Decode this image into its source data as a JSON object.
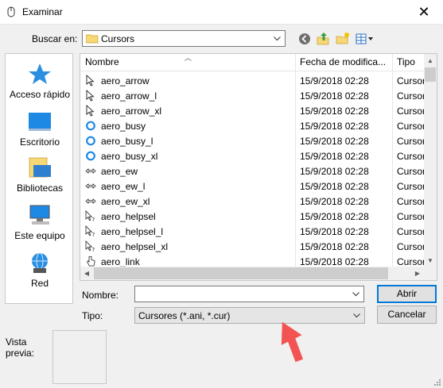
{
  "window": {
    "title": "Examinar",
    "close_glyph": "✕"
  },
  "lookin": {
    "label": "Buscar en:",
    "value": "Cursors"
  },
  "toolbar": {
    "icons": [
      "back-icon",
      "up-folder-icon",
      "new-folder-icon",
      "view-menu-icon"
    ]
  },
  "places": [
    {
      "label": "Acceso rápido",
      "icon": "star-icon"
    },
    {
      "label": "Escritorio",
      "icon": "desktop-icon"
    },
    {
      "label": "Bibliotecas",
      "icon": "libraries-icon"
    },
    {
      "label": "Este equipo",
      "icon": "computer-icon"
    },
    {
      "label": "Red",
      "icon": "network-icon"
    }
  ],
  "columns": {
    "name": "Nombre",
    "date": "Fecha de modifica...",
    "type": "Tipo"
  },
  "files": [
    {
      "name": "aero_arrow",
      "date": "15/9/2018 02:28",
      "type": "Cursor",
      "icon": "arrow"
    },
    {
      "name": "aero_arrow_l",
      "date": "15/9/2018 02:28",
      "type": "Cursor",
      "icon": "arrow"
    },
    {
      "name": "aero_arrow_xl",
      "date": "15/9/2018 02:28",
      "type": "Cursor",
      "icon": "arrow"
    },
    {
      "name": "aero_busy",
      "date": "15/9/2018 02:28",
      "type": "Cursor",
      "icon": "busy"
    },
    {
      "name": "aero_busy_l",
      "date": "15/9/2018 02:28",
      "type": "Cursor",
      "icon": "busy"
    },
    {
      "name": "aero_busy_xl",
      "date": "15/9/2018 02:28",
      "type": "Cursor",
      "icon": "busy"
    },
    {
      "name": "aero_ew",
      "date": "15/9/2018 02:28",
      "type": "Cursor",
      "icon": "ew"
    },
    {
      "name": "aero_ew_l",
      "date": "15/9/2018 02:28",
      "type": "Cursor",
      "icon": "ew"
    },
    {
      "name": "aero_ew_xl",
      "date": "15/9/2018 02:28",
      "type": "Cursor",
      "icon": "ew"
    },
    {
      "name": "aero_helpsel",
      "date": "15/9/2018 02:28",
      "type": "Cursor",
      "icon": "help"
    },
    {
      "name": "aero_helpsel_l",
      "date": "15/9/2018 02:28",
      "type": "Cursor",
      "icon": "help"
    },
    {
      "name": "aero_helpsel_xl",
      "date": "15/9/2018 02:28",
      "type": "Cursor",
      "icon": "help"
    },
    {
      "name": "aero_link",
      "date": "15/9/2018 02:28",
      "type": "Cursor",
      "icon": "link"
    }
  ],
  "filename": {
    "label": "Nombre:",
    "value": ""
  },
  "filetype": {
    "label": "Tipo:",
    "value": "Cursores (*.ani, *.cur)"
  },
  "buttons": {
    "open": "Abrir",
    "cancel": "Cancelar"
  },
  "preview": {
    "label": "Vista\nprevia:"
  },
  "colors": {
    "accent": "#0078d7",
    "annotation_arrow": "#f25454",
    "folder": "#f8d775"
  }
}
